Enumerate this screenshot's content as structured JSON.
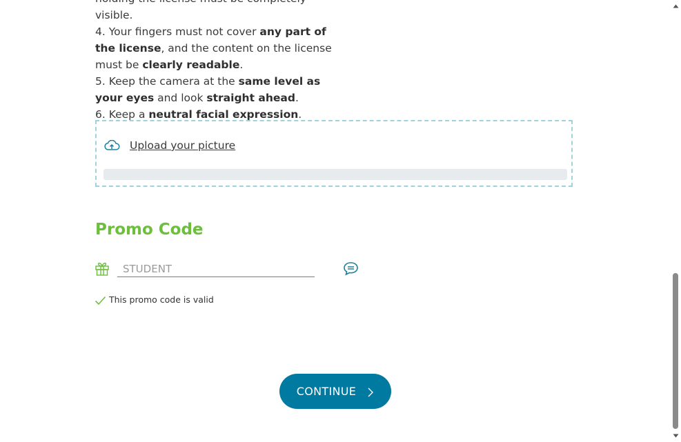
{
  "instructions": {
    "line0": "holding the license must be completely visible.",
    "item4": {
      "a": "4. Your fingers must not cover ",
      "b": "any part of the license",
      "c": ", and the content on the license must be ",
      "d": "clearly readable",
      "e": "."
    },
    "item5": {
      "a": "5. Keep the camera at the ",
      "b": "same level as your eyes",
      "c": " and look ",
      "d": "straight ahead",
      "e": "."
    },
    "item6": {
      "a": "6. Keep a ",
      "b": "neutral facial expression",
      "c": "."
    }
  },
  "upload": {
    "icon": "cloud-upload-icon",
    "link_label": "Upload your picture",
    "progress_fraction": 0
  },
  "promo": {
    "title": "Promo Code",
    "gift_icon": "gift-icon",
    "input_value": "",
    "input_placeholder": "STUDENT",
    "chat_icon": "chat-bubble-icon",
    "status_icon": "checkmark-icon",
    "status_text": "This promo code is valid"
  },
  "continue_button": {
    "label": "CONTINUE",
    "icon": "chevron-right-icon"
  },
  "colors": {
    "accent_green": "#6cbf3b",
    "primary_button": "#007aa0",
    "upload_border": "#9fd3dc",
    "icon_teal": "#1b7f9f"
  }
}
